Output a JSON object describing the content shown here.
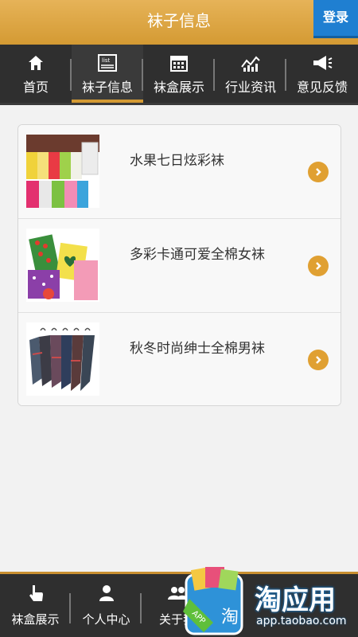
{
  "header": {
    "title": "袜子信息",
    "login_label": "登录"
  },
  "topnav": {
    "items": [
      {
        "label": "首页",
        "icon": "home-icon"
      },
      {
        "label": "袜子信息",
        "icon": "list-icon",
        "active": true
      },
      {
        "label": "袜盒展示",
        "icon": "calendar-icon"
      },
      {
        "label": "行业资讯",
        "icon": "chart-icon"
      },
      {
        "label": "意见反馈",
        "icon": "megaphone-icon"
      }
    ]
  },
  "products": [
    {
      "name": "水果七日炫彩袜"
    },
    {
      "name": "多彩卡通可爱全棉女袜"
    },
    {
      "name": "秋冬时尚绅士全棉男袜"
    }
  ],
  "bottombar": {
    "items": [
      {
        "label": "袜盒展示",
        "icon": "hand-pointer-icon"
      },
      {
        "label": "个人中心",
        "icon": "person-icon"
      },
      {
        "label": "关于我",
        "icon": "group-icon"
      }
    ]
  },
  "watermark": {
    "brand": "淘应用",
    "url": "app.taobao.com"
  },
  "colors": {
    "accent": "#d49a33",
    "nav_bg": "#2f2f2f",
    "login_bg": "#1f7fd1"
  }
}
